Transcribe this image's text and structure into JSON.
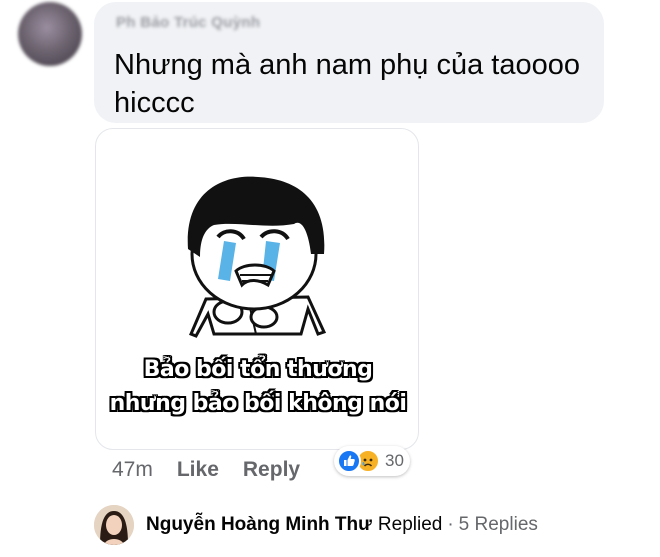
{
  "comment": {
    "author_name_blurred": "Ph Bảo Trúc Quỳnh",
    "text": "Nhưng mà anh nam phụ của taoooo hicccc"
  },
  "sticker": {
    "caption_line1": "Bảo bối tổn thương",
    "caption_line2": "nhưng bảo bối không nói"
  },
  "actions": {
    "time": "47m",
    "like_label": "Like",
    "reply_label": "Reply",
    "reaction_count": "30",
    "reaction_icons": [
      "like-icon",
      "sad-icon"
    ]
  },
  "reply_preview": {
    "name": "Nguyễn Hoàng Minh Thư",
    "action": "Replied",
    "separator": "·",
    "replies_count": "5 Replies"
  },
  "colors": {
    "bubble": "#f0f2f5",
    "secondary_text": "#65676b",
    "like_blue": "#1877f2",
    "sad_yellow": "#f7b125"
  }
}
